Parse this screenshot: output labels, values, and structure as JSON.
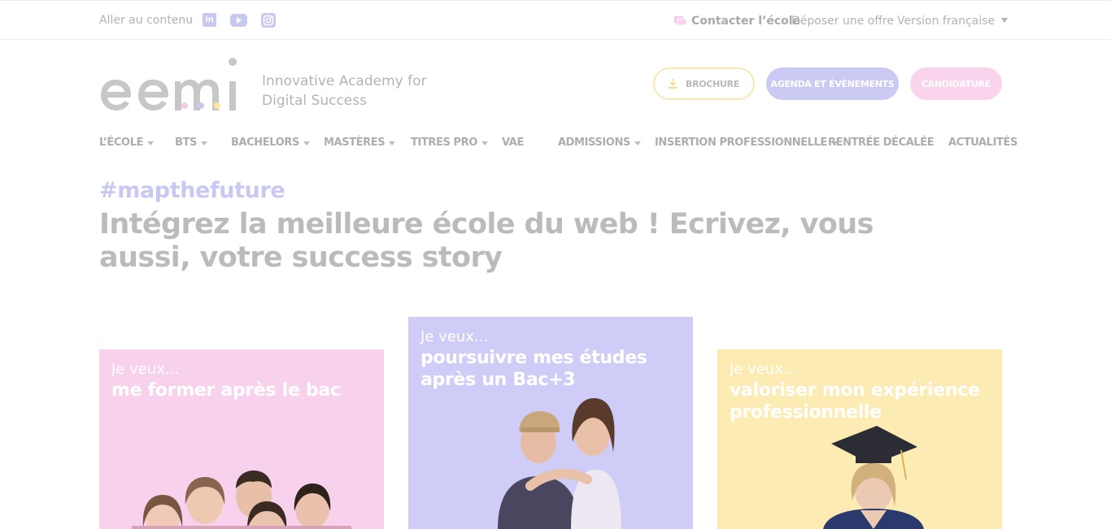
{
  "topbar": {
    "skip_link": "Aller au contenu",
    "social": [
      "linkedin-icon",
      "youtube-icon",
      "instagram-icon"
    ],
    "contact": "Contacter l’école",
    "deposer": "Déposer une offre",
    "language": "Version française"
  },
  "header": {
    "logo_text": "eemi",
    "tagline_line1": "Innovative Academy for",
    "tagline_line2": "Digital Success",
    "buttons": {
      "brochure": "Brochure",
      "agenda": "Agenda et événements",
      "candidature": "Candidature"
    }
  },
  "nav": {
    "items": [
      {
        "label": "L’école",
        "dropdown": true
      },
      {
        "label": "BTS",
        "dropdown": true
      },
      {
        "label": "Bachelors",
        "dropdown": true
      },
      {
        "label": "Mastères",
        "dropdown": true
      },
      {
        "label": "Titres pro",
        "dropdown": true
      },
      {
        "label": "VAE",
        "dropdown": false
      },
      {
        "label": "Admissions",
        "dropdown": true
      },
      {
        "label": "Insertion professionnelle",
        "dropdown": true
      },
      {
        "label": "Rentrée décalée",
        "dropdown": false
      },
      {
        "label": "Actualités",
        "dropdown": false
      }
    ]
  },
  "hero": {
    "hashtag": "#mapthefuture",
    "headline": "Intégrez la meilleure école du web ! Ecrivez, vous aussi, votre success story"
  },
  "cards": [
    {
      "pre": "Je veux...",
      "title": "me former après le bac"
    },
    {
      "pre": "Je veux...",
      "title": "poursuivre mes études après un Bac+3"
    },
    {
      "pre": "Je veux...",
      "title": "valoriser mon expérience professionnelle"
    }
  ],
  "colors": {
    "lavender": "#cfcdf7",
    "pink": "#f8d1ec",
    "yellow": "#fdebb4",
    "text_gray": "#b4b4b4"
  }
}
